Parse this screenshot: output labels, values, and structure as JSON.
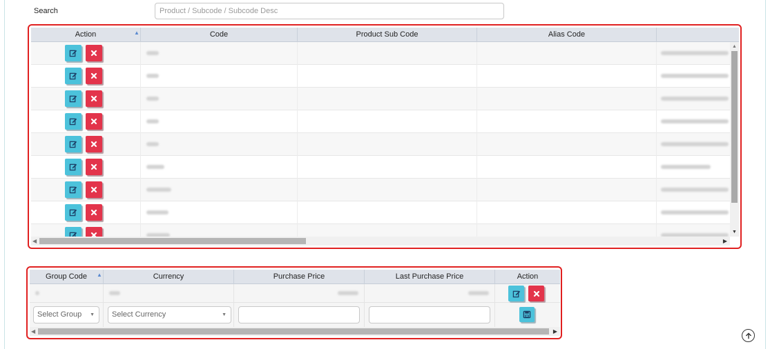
{
  "search": {
    "label": "Search",
    "placeholder": "Product / Subcode / Subcode Desc",
    "value": ""
  },
  "product_grid": {
    "columns": [
      "Action",
      "Code",
      "Product Sub Code",
      "Alias Code"
    ],
    "sorted_column": "Action",
    "rows": 9,
    "row_actions": [
      "edit-icon",
      "delete-icon"
    ]
  },
  "price_grid": {
    "columns": [
      "Group Code",
      "Currency",
      "Purchase Price",
      "Last Purchase Price",
      "Action"
    ],
    "sorted_column": "Group Code",
    "new_row": {
      "group_placeholder": "Select Group",
      "currency_placeholder": "Select Currency",
      "purchase_price": "",
      "last_purchase_price": ""
    }
  },
  "icons": {
    "edit": "edit-icon",
    "delete": "delete-icon",
    "save": "save-icon",
    "scroll_top": "arrow-up-circle-icon"
  },
  "colors": {
    "edit_button": "#4cc2db",
    "delete_button": "#e3344b",
    "highlight_border": "#e02020",
    "header_bg": "#dfe3ea"
  }
}
